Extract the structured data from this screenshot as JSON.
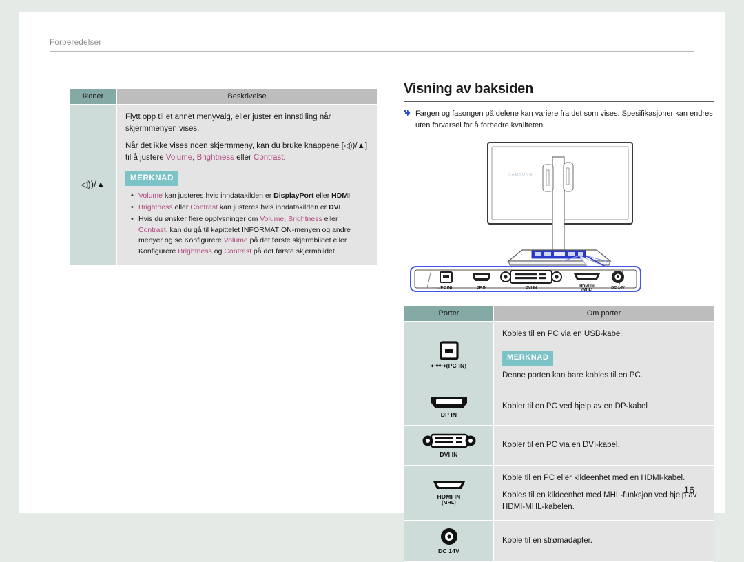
{
  "document": {
    "breadcrumb": "Forberedelser",
    "page_number": "16",
    "colors": {
      "header_teal": "#85aaa6",
      "header_gray": "#bdbdbd",
      "icon_cell": "#cddcd9",
      "desc_cell": "#e4e4e4",
      "badge_teal": "#7cc3c8",
      "highlight_magenta": "#b0497f",
      "callout_blue": "#2a4bd7",
      "page_bg": "#e4eae5"
    }
  },
  "icons_table": {
    "headers": {
      "icons": "Ikoner",
      "description": "Beskrivelse"
    },
    "row": {
      "icon_glyph": "◁))/▲",
      "icon_name": "volume-up-icon",
      "para1": "Flytt opp til et annet menyvalg, eller juster en innstilling når skjermmenyen vises.",
      "para2_a": "Når det ikke vises noen skjermmeny, kan du bruke knappene [◁))/▲] til å justere ",
      "para2_volume": "Volume",
      "para2_b": ", ",
      "para2_brightness": "Brightness",
      "para2_c": " eller ",
      "para2_contrast": "Contrast",
      "para2_d": ".",
      "note_badge": "MERKNAD",
      "notes": [
        {
          "seg": [
            {
              "t": "Volume",
              "s": "hl"
            },
            {
              "t": " kan justeres hvis inndatakilden er ",
              "s": ""
            },
            {
              "t": "DisplayPort",
              "s": "bold"
            },
            {
              "t": " eller ",
              "s": ""
            },
            {
              "t": "HDMI",
              "s": "bold"
            },
            {
              "t": ".",
              "s": ""
            }
          ]
        },
        {
          "seg": [
            {
              "t": "Brightness",
              "s": "hl"
            },
            {
              "t": " eller ",
              "s": ""
            },
            {
              "t": "Contrast",
              "s": "hl"
            },
            {
              "t": " kan justeres hvis inndatakilden er ",
              "s": ""
            },
            {
              "t": "DVI",
              "s": "bold"
            },
            {
              "t": ".",
              "s": ""
            }
          ]
        },
        {
          "seg": [
            {
              "t": "Hvis du ønsker flere opplysninger om ",
              "s": ""
            },
            {
              "t": "Volume",
              "s": "hl"
            },
            {
              "t": ", ",
              "s": ""
            },
            {
              "t": "Brightness",
              "s": "hl"
            },
            {
              "t": " eller ",
              "s": ""
            },
            {
              "t": "Contrast",
              "s": "hl"
            },
            {
              "t": ", kan du gå til kapittelet INFORMATION-menyen og andre menyer og se Konfigurere ",
              "s": ""
            },
            {
              "t": "Volume",
              "s": "hl"
            },
            {
              "t": " på det første skjermbildet eller Konfigurere ",
              "s": ""
            },
            {
              "t": "Brightness",
              "s": "hl"
            },
            {
              "t": " og ",
              "s": ""
            },
            {
              "t": "Contrast",
              "s": "hl"
            },
            {
              "t": " på det første skjermbildet.",
              "s": ""
            }
          ]
        }
      ]
    }
  },
  "section": {
    "title": "Visning av baksiden",
    "note": "Fargen og fasongen på delene kan variere fra det som vises. Spesifikasjoner kan endres uten forvarsel for å forbedre kvaliteten."
  },
  "illustration": {
    "brand_logo": "SAMSUNG",
    "panel_port_labels": [
      "(PC IN)",
      "DP IN",
      "DVI IN",
      "HDMI IN",
      "(MHL)",
      "DC 14V"
    ]
  },
  "ports_table": {
    "headers": {
      "ports": "Porter",
      "about": "Om porter"
    },
    "rows": [
      {
        "icon_name": "usb-type-b-port-icon",
        "label": "(PC IN)",
        "sublabel": "",
        "desc1": "Kobles til en PC via en USB-kabel.",
        "badge": "MERKNAD",
        "desc2": "Denne porten kan bare kobles til en PC."
      },
      {
        "icon_name": "displayport-port-icon",
        "label": "DP IN",
        "sublabel": "",
        "desc1": "Kobler til en PC ved hjelp av en DP-kabel",
        "badge": "",
        "desc2": ""
      },
      {
        "icon_name": "dvi-port-icon",
        "label": "DVI IN",
        "sublabel": "",
        "desc1": "Kobler til en PC via en DVI-kabel.",
        "badge": "",
        "desc2": ""
      },
      {
        "icon_name": "hdmi-mhl-port-icon",
        "label": "HDMI IN",
        "sublabel": "(MHL)",
        "desc1": "Koble til en PC eller kildeenhet med en HDMI-kabel.",
        "badge": "",
        "desc2": "Kobles til en kildeenhet med MHL-funksjon ved hjelp av HDMI-MHL-kabelen."
      },
      {
        "icon_name": "dc-power-port-icon",
        "label": "DC 14V",
        "sublabel": "",
        "desc1": "Koble til en strømadapter.",
        "badge": "",
        "desc2": ""
      }
    ]
  }
}
